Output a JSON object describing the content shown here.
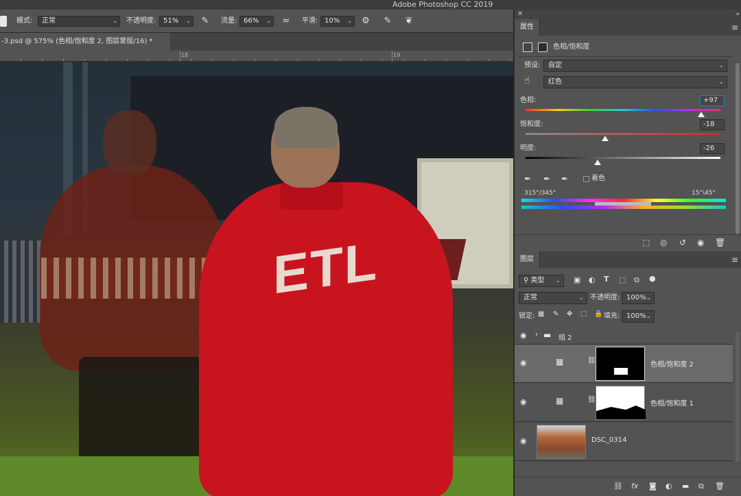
{
  "app": {
    "title": "Adobe Photoshop CC 2019"
  },
  "options": {
    "mode_label": "模式:",
    "mode_value": "正常",
    "opacity_label": "不透明度:",
    "opacity_value": "51%",
    "flow_label": "流量:",
    "flow_value": "66%",
    "smoothing_label": "平滑:",
    "smoothing_value": "10%"
  },
  "document": {
    "tab_title": "-3.psd @ 575% (色相/饱和度 2, 图层蒙版/16) *",
    "ruler_marks": [
      "18",
      "19"
    ],
    "image_text": "ETL"
  },
  "properties": {
    "tab": "属性",
    "adjustment_name": "色相/饱和度",
    "preset_label": "预设:",
    "preset_value": "自定",
    "channel_value": "红色",
    "hue_label": "色相:",
    "hue_value": "+97",
    "hue_fraction": 0.9,
    "saturation_label": "饱和度:",
    "saturation_value": "-18",
    "saturation_fraction": 0.41,
    "lightness_label": "明度:",
    "lightness_value": "-26",
    "lightness_fraction": 0.37,
    "colorize_label": "着色",
    "range_left": "315°/345°",
    "range_right": "15°\\45°"
  },
  "layers": {
    "tab": "图层",
    "filter_value": "类型",
    "blend_value": "正常",
    "opacity_label": "不透明度:",
    "opacity_value": "100%",
    "lock_label": "锁定:",
    "fill_label": "填充:",
    "fill_value": "100%",
    "items": [
      {
        "name": "组 2"
      },
      {
        "name": "色相/饱和度 2"
      },
      {
        "name": "色相/饱和度 1"
      },
      {
        "name": "DSC_0314"
      }
    ]
  },
  "colors": {
    "panel_bg": "#535353",
    "selected_layer": "#6a6a6a",
    "focus_blue": "#2f78c9"
  }
}
